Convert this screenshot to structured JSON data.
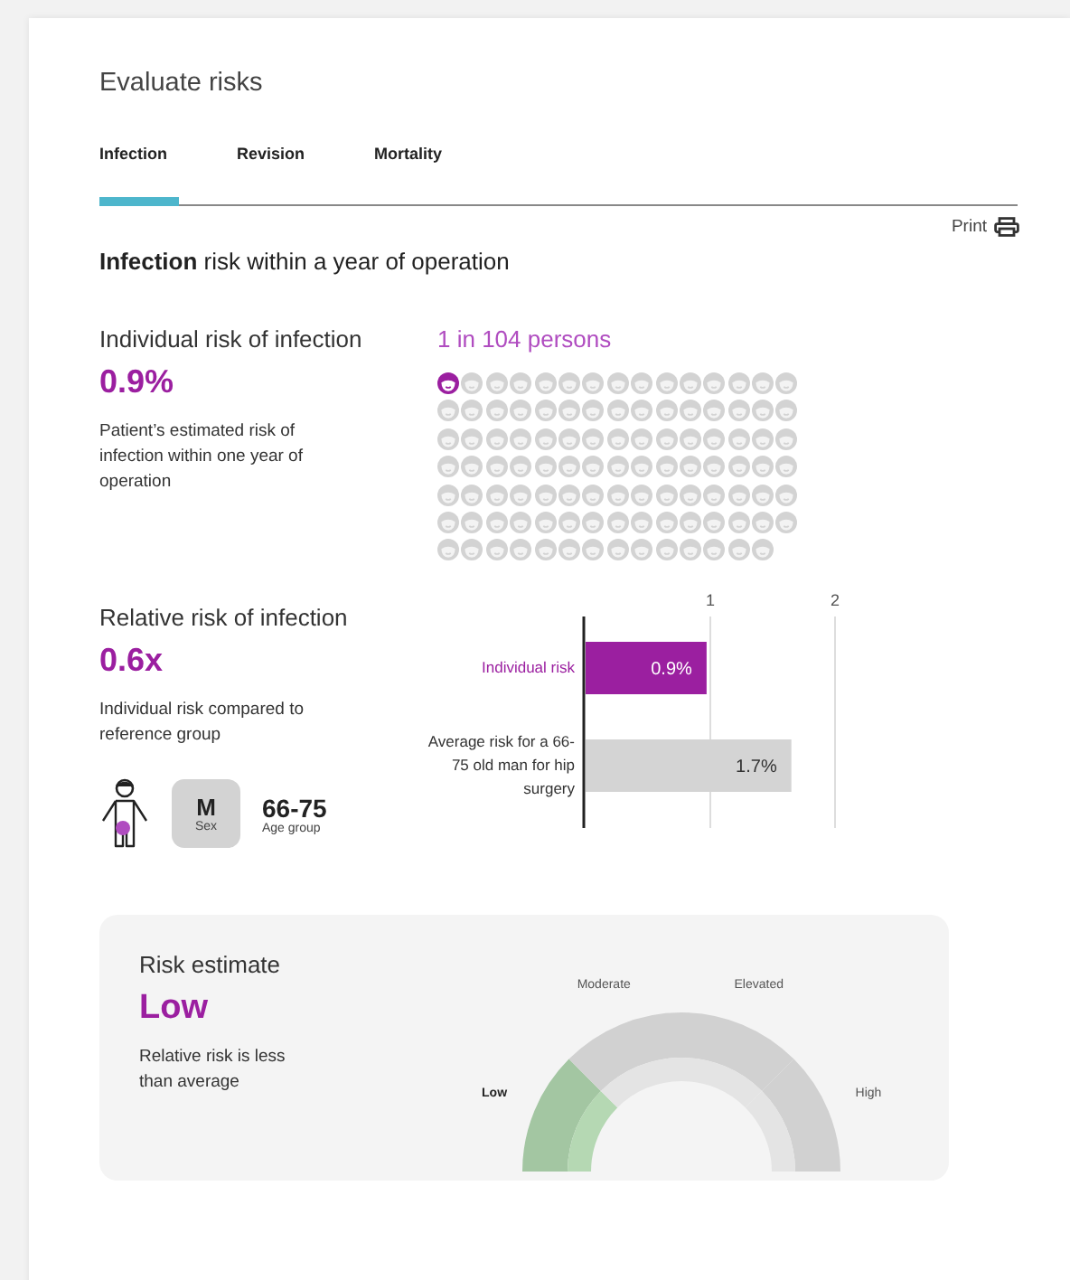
{
  "title": "Evaluate risks",
  "tabs": [
    {
      "label": "Infection",
      "selected": true
    },
    {
      "label": "Revision",
      "selected": false
    },
    {
      "label": "Mortality",
      "selected": false
    }
  ],
  "print": {
    "label": "Print"
  },
  "heading": "**Infection** risk within a year of operation",
  "individual": {
    "title": "Individual risk of infection",
    "value": "0.9%",
    "description": "Patient’s estimated risk of infection within one year of operation",
    "ratio": "1 in 104 persons",
    "people": [
      {
        "highlighted": true
      },
      {
        "highlighted": false
      },
      {
        "highlighted": false
      },
      {
        "highlighted": false
      },
      {
        "highlighted": false
      },
      {
        "highlighted": false
      },
      {
        "highlighted": false
      },
      {
        "highlighted": false
      },
      {
        "highlighted": false
      },
      {
        "highlighted": false
      },
      {
        "highlighted": false
      },
      {
        "highlighted": false
      },
      {
        "highlighted": false
      },
      {
        "highlighted": false
      },
      {
        "highlighted": false
      },
      {
        "highlighted": false
      },
      {
        "highlighted": false
      },
      {
        "highlighted": false
      },
      {
        "highlighted": false
      },
      {
        "highlighted": false
      },
      {
        "highlighted": false
      },
      {
        "highlighted": false
      },
      {
        "highlighted": false
      },
      {
        "highlighted": false
      },
      {
        "highlighted": false
      },
      {
        "highlighted": false
      },
      {
        "highlighted": false
      },
      {
        "highlighted": false
      },
      {
        "highlighted": false
      },
      {
        "highlighted": false
      },
      {
        "highlighted": false
      },
      {
        "highlighted": false
      },
      {
        "highlighted": false
      },
      {
        "highlighted": false
      },
      {
        "highlighted": false
      },
      {
        "highlighted": false
      },
      {
        "highlighted": false
      },
      {
        "highlighted": false
      },
      {
        "highlighted": false
      },
      {
        "highlighted": false
      },
      {
        "highlighted": false
      },
      {
        "highlighted": false
      },
      {
        "highlighted": false
      },
      {
        "highlighted": false
      },
      {
        "highlighted": false
      },
      {
        "highlighted": false
      },
      {
        "highlighted": false
      },
      {
        "highlighted": false
      },
      {
        "highlighted": false
      },
      {
        "highlighted": false
      },
      {
        "highlighted": false
      },
      {
        "highlighted": false
      },
      {
        "highlighted": false
      },
      {
        "highlighted": false
      },
      {
        "highlighted": false
      },
      {
        "highlighted": false
      },
      {
        "highlighted": false
      },
      {
        "highlighted": false
      },
      {
        "highlighted": false
      },
      {
        "highlighted": false
      },
      {
        "highlighted": false
      },
      {
        "highlighted": false
      },
      {
        "highlighted": false
      },
      {
        "highlighted": false
      },
      {
        "highlighted": false
      },
      {
        "highlighted": false
      },
      {
        "highlighted": false
      },
      {
        "highlighted": false
      },
      {
        "highlighted": false
      },
      {
        "highlighted": false
      },
      {
        "highlighted": false
      },
      {
        "highlighted": false
      },
      {
        "highlighted": false
      },
      {
        "highlighted": false
      },
      {
        "highlighted": false
      },
      {
        "highlighted": false
      },
      {
        "highlighted": false
      },
      {
        "highlighted": false
      },
      {
        "highlighted": false
      },
      {
        "highlighted": false
      },
      {
        "highlighted": false
      },
      {
        "highlighted": false
      },
      {
        "highlighted": false
      },
      {
        "highlighted": false
      },
      {
        "highlighted": false
      },
      {
        "highlighted": false
      },
      {
        "highlighted": false
      },
      {
        "highlighted": false
      },
      {
        "highlighted": false
      },
      {
        "highlighted": false
      },
      {
        "highlighted": false
      },
      {
        "highlighted": false
      },
      {
        "highlighted": false
      },
      {
        "highlighted": false
      },
      {
        "highlighted": false
      },
      {
        "highlighted": false
      },
      {
        "highlighted": false
      },
      {
        "highlighted": false
      },
      {
        "highlighted": false
      },
      {
        "highlighted": false
      },
      {
        "highlighted": false
      },
      {
        "highlighted": false
      },
      {
        "highlighted": false
      },
      {
        "highlighted": false
      }
    ]
  },
  "relative": {
    "title": "Relative risk of infection",
    "value": "0.6x",
    "description": "Individual risk compared to reference group",
    "patient": {
      "sex": "M",
      "sex_label": "Sex",
      "age_group": "66-75",
      "age_label": "Age group"
    },
    "chart_data": {
      "type": "bar",
      "orientation": "horizontal",
      "categories": [
        "Individual risk",
        "Average risk for a 66-75 old man for hip surgery"
      ],
      "series": [
        {
          "color": "#9b1fa0",
          "values": [
            0.97,
            null
          ]
        },
        {
          "color": "#d4d4d4",
          "values": [
            null,
            1.65
          ]
        }
      ],
      "xlim": [
        0,
        2
      ],
      "xticks": [
        1,
        2
      ],
      "stacked": true,
      "value_labels": [
        "0.9%",
        "1.7%"
      ]
    }
  },
  "risk_estimate": {
    "title": "Risk estimate",
    "value": "Low",
    "description": "Relative risk is less than average",
    "levels": [
      {
        "label": "Low",
        "selected": true
      },
      {
        "label": "Moderate",
        "selected": false
      },
      {
        "label": "Elevated",
        "selected": false
      },
      {
        "label": "High",
        "selected": false
      }
    ]
  }
}
